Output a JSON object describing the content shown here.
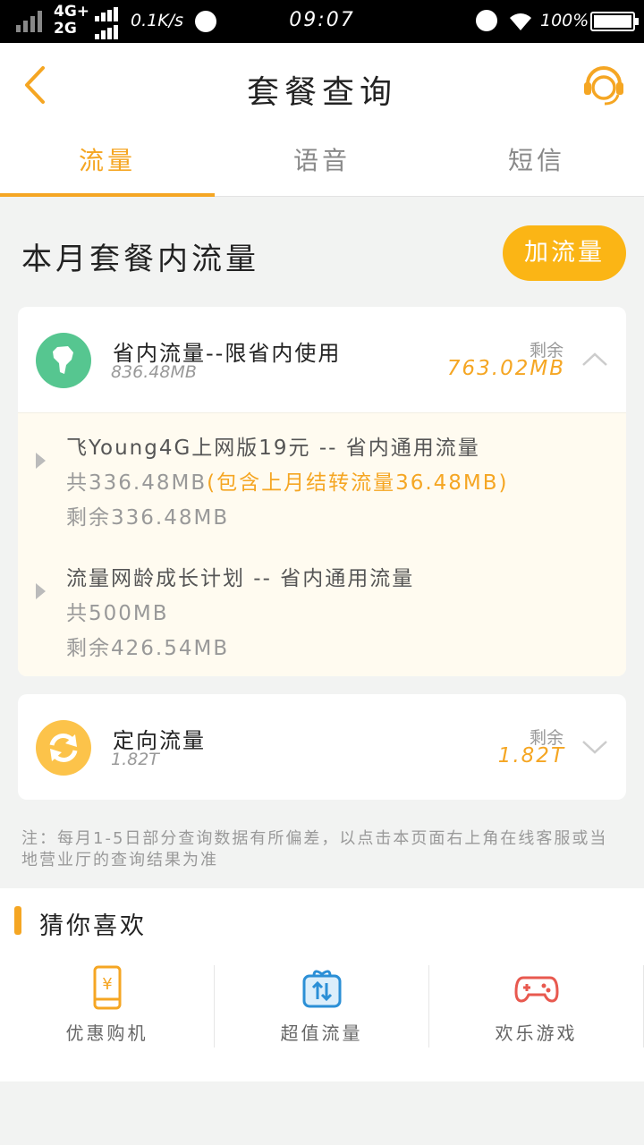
{
  "status_bar": {
    "network_top": "4G+",
    "network_bottom": "2G",
    "speed": "0.1K/s",
    "time": "09:07",
    "battery": "100%"
  },
  "header": {
    "title": "套餐查询"
  },
  "tabs": [
    {
      "label": "流量",
      "active": true
    },
    {
      "label": "语音",
      "active": false
    },
    {
      "label": "短信",
      "active": false
    }
  ],
  "section": {
    "title": "本月套餐内流量",
    "add_button": "加流量"
  },
  "cards": [
    {
      "name": "省内流量--限省内使用",
      "total": "836.48MB",
      "remain_label": "剩余",
      "remain_value": "763.02MB",
      "expanded": true,
      "details": [
        {
          "title": "飞Young4G上网版19元 -- 省内通用流量",
          "total": "共336.48MB",
          "carry_over": "(包含上月结转流量36.48MB)",
          "remain": "剩余336.48MB"
        },
        {
          "title": "流量网龄成长计划 -- 省内通用流量",
          "total": "共500MB",
          "carry_over": "",
          "remain": "剩余426.54MB"
        }
      ]
    },
    {
      "name": "定向流量",
      "total": "1.82T",
      "remain_label": "剩余",
      "remain_value": "1.82T",
      "expanded": false
    }
  ],
  "note": "注：每月1-5日部分查询数据有所偏差，以点击本页面右上角在线客服或当地营业厅的查询结果为准",
  "recommend": {
    "title": "猜你喜欢",
    "items": [
      {
        "label": "优惠购机",
        "icon": "phone-yuan-icon"
      },
      {
        "label": "超值流量",
        "icon": "gift-data-icon"
      },
      {
        "label": "欢乐游戏",
        "icon": "gamepad-icon"
      }
    ]
  },
  "colors": {
    "accent": "#f5a623",
    "button": "#fbb515",
    "green_icon": "#56c690",
    "orange_icon": "#fcc34a"
  }
}
